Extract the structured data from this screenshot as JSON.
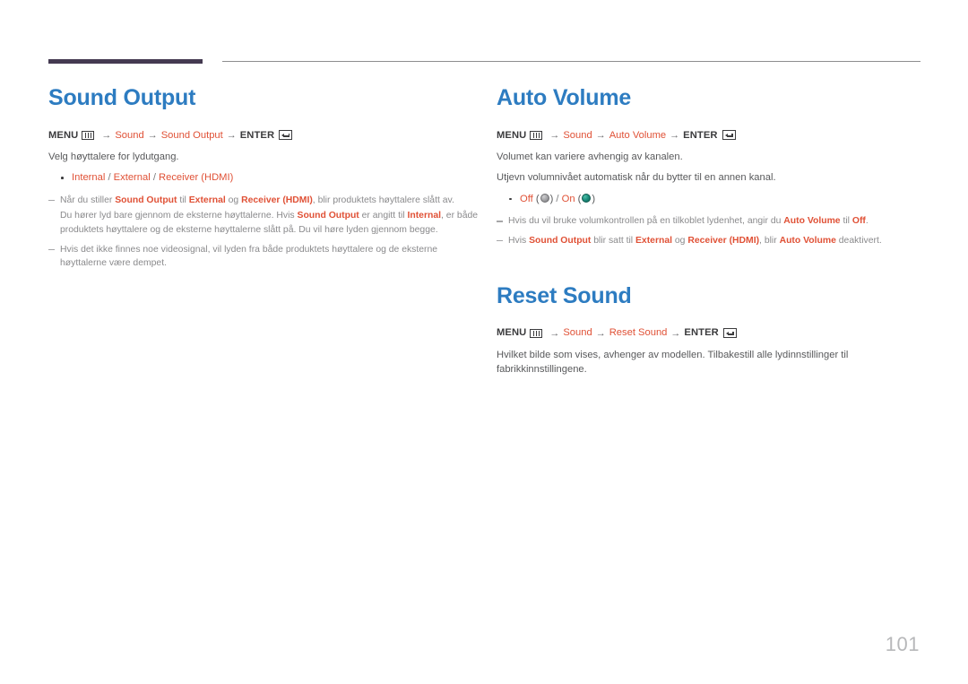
{
  "page": {
    "number": "101",
    "accent_blue": "#2d7cc1",
    "accent_orange": "#e05136",
    "rule_purple": "#443a51",
    "body_gray": "#58595b",
    "note_gray": "#8a8a8c"
  },
  "menu_labels": {
    "menu": "MENU",
    "enter": "ENTER",
    "arrow": "→",
    "menu_icon": "menu-grid-icon",
    "enter_icon": "enter-return-icon"
  },
  "sections": [
    {
      "id": "sound-output",
      "title": "Sound Output",
      "path": [
        "Sound",
        "Sound Output"
      ],
      "intro": "Velg høyttalere for lydutgang.",
      "options": {
        "items": [
          "Internal",
          "External",
          "Receiver (HDMI)"
        ],
        "separator": "/"
      },
      "notes": [
        {
          "paragraphs": [
            "Når du stiller Sound Output til External og Receiver (HDMI), blir produktets høyttalere slått av.",
            "Du hører lyd bare gjennom de eksterne høyttalerne. Hvis Sound Output er angitt til Internal, er både produktets høyttalere og de eksterne høyttalerne slått på. Du vil høre lyden gjennom begge."
          ]
        },
        {
          "paragraphs": [
            "Hvis det ikke finnes noe videosignal, vil lyden fra både produktets høyttalere og de eksterne høyttalerne være dempet."
          ]
        }
      ]
    },
    {
      "id": "auto-volume",
      "title": "Auto Volume",
      "path": [
        "Sound",
        "Auto Volume"
      ],
      "intro": "Volumet kan variere avhengig av kanalen.",
      "intro2": "Utjevn volumnivået automatisk når du bytter til en annen kanal.",
      "toggle_options": {
        "off_label": "Off",
        "on_label": "On",
        "separator": "/",
        "off_icon": "sphere-off-gray-icon",
        "on_icon": "sphere-on-teal-icon",
        "off_color": "#a8a8ab",
        "on_color": "#1e9180"
      },
      "notes": [
        {
          "paragraphs": [
            "Hvis du vil bruke volumkontrollen på en tilkoblet lydenhet, angir du Auto Volume til Off."
          ]
        },
        {
          "paragraphs": [
            "Hvis Sound Output blir satt til External og Receiver (HDMI), blir Auto Volume deaktivert."
          ]
        }
      ]
    },
    {
      "id": "reset-sound",
      "title": "Reset Sound",
      "path": [
        "Sound",
        "Reset Sound"
      ],
      "intro": "Hvilket bilde som vises, avhenger av modellen. Tilbakestill alle lydinnstillinger til fabrikkinnstillingene."
    }
  ]
}
